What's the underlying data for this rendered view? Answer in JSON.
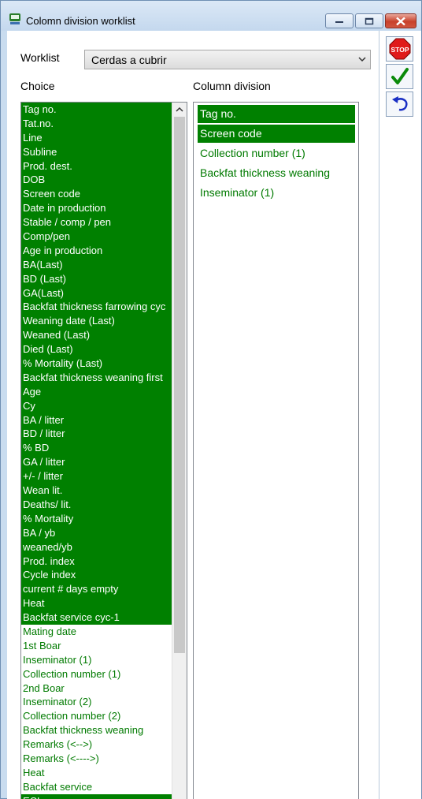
{
  "window": {
    "title": "Colomn division worklist"
  },
  "toolbar": {
    "stop_label": "STOP"
  },
  "worklist": {
    "label": "Worklist",
    "value": "Cerdas a cubrir"
  },
  "choice": {
    "label": "Choice",
    "items": [
      {
        "label": "Tag no.",
        "selected": true
      },
      {
        "label": "Tat.no.",
        "selected": true
      },
      {
        "label": "Line",
        "selected": true
      },
      {
        "label": "Subline",
        "selected": true
      },
      {
        "label": "Prod. dest.",
        "selected": true
      },
      {
        "label": "DOB",
        "selected": true
      },
      {
        "label": "Screen code",
        "selected": true
      },
      {
        "label": "Date in production",
        "selected": true
      },
      {
        "label": "Stable / comp / pen",
        "selected": true
      },
      {
        "label": "Comp/pen",
        "selected": true
      },
      {
        "label": "Age in production",
        "selected": true
      },
      {
        "label": "BA(Last)",
        "selected": true
      },
      {
        "label": "BD (Last)",
        "selected": true
      },
      {
        "label": "GA(Last)",
        "selected": true
      },
      {
        "label": "Backfat thickness farrowing cyc",
        "selected": true
      },
      {
        "label": "Weaning date (Last)",
        "selected": true
      },
      {
        "label": "Weaned (Last)",
        "selected": true
      },
      {
        "label": "Died (Last)",
        "selected": true
      },
      {
        "label": "% Mortality (Last)",
        "selected": true
      },
      {
        "label": "Backfat thickness weaning first",
        "selected": true
      },
      {
        "label": "Age",
        "selected": true
      },
      {
        "label": "Cy",
        "selected": true
      },
      {
        "label": "BA / litter",
        "selected": true
      },
      {
        "label": "BD / litter",
        "selected": true
      },
      {
        "label": "% BD",
        "selected": true
      },
      {
        "label": "GA / litter",
        "selected": true
      },
      {
        "label": "+/- /  litter",
        "selected": true
      },
      {
        "label": "Wean lit.",
        "selected": true
      },
      {
        "label": "Deaths/ lit.",
        "selected": true
      },
      {
        "label": "% Mortality",
        "selected": true
      },
      {
        "label": "BA / yb",
        "selected": true
      },
      {
        "label": "weaned/yb",
        "selected": true
      },
      {
        "label": "Prod. index",
        "selected": true
      },
      {
        "label": "Cycle index",
        "selected": true
      },
      {
        "label": "current # days empty",
        "selected": true
      },
      {
        "label": "Heat",
        "selected": true
      },
      {
        "label": "Backfat service cyc-1",
        "selected": true
      },
      {
        "label": "Mating date",
        "selected": false
      },
      {
        "label": "1st Boar",
        "selected": false
      },
      {
        "label": "Inseminator (1)",
        "selected": false
      },
      {
        "label": "Collection number (1)",
        "selected": false
      },
      {
        "label": "2nd Boar",
        "selected": false
      },
      {
        "label": "Inseminator (2)",
        "selected": false
      },
      {
        "label": "Collection number (2)",
        "selected": false
      },
      {
        "label": "Backfat thickness weaning",
        "selected": false
      },
      {
        "label": "Remarks (<-->)",
        "selected": false
      },
      {
        "label": "Remarks (<---->)",
        "selected": false
      },
      {
        "label": "Heat",
        "selected": false
      },
      {
        "label": "Backfat service",
        "selected": false
      },
      {
        "label": "ECL",
        "selected": true
      }
    ]
  },
  "column_division": {
    "label": "Column division",
    "items": [
      {
        "label": "Tag no.",
        "selected": true
      },
      {
        "label": "Screen code",
        "selected": true
      },
      {
        "label": "Collection number (1)",
        "selected": false
      },
      {
        "label": "Backfat thickness weaning",
        "selected": false
      },
      {
        "label": "Inseminator (1)",
        "selected": false
      }
    ]
  },
  "colors": {
    "selected_bg": "#008000",
    "unselected_text": "#007a00"
  }
}
